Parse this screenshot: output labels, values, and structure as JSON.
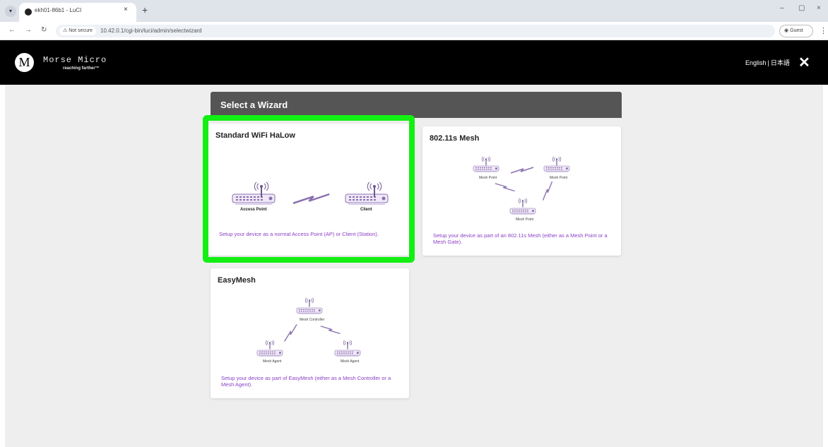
{
  "browser": {
    "tab_title": "ekh01-86b1 - LuCI",
    "tab_close": "×",
    "new_tab": "+",
    "tab_list": "▾",
    "not_secure": "⚠ Not secure",
    "url": "10.42.0.1/cgi-bin/luci/admin/selectwizard",
    "guest": "Guest",
    "window_controls": [
      "–",
      "▢",
      "×"
    ]
  },
  "header": {
    "logo_letter": "M",
    "brand_name": "Morse Micro",
    "brand_tagline": "reaching farther™",
    "lang_english": "English",
    "lang_sep": "|",
    "lang_japanese": "日本語",
    "close": "✕"
  },
  "page": {
    "title": "Select a Wizard"
  },
  "wizards": [
    {
      "title": "Standard WiFi HaLow",
      "desc": "Setup your device as a normal Access Point (AP) or Client (Station).",
      "labels": [
        "Access Point",
        "Client"
      ]
    },
    {
      "title": "802.11s Mesh",
      "desc": "Setup your device as part of an 802.11s Mesh (either as a Mesh Point or a Mesh Gate).",
      "labels": [
        "Mesh Point",
        "Mesh Point",
        "Mesh Point"
      ]
    },
    {
      "title": "EasyMesh",
      "desc": "Setup your device as part of EasyMesh (either as a Mesh Controller or a Mesh Agent).",
      "labels": [
        "Mesh Controller",
        "Mesh Agent",
        "Mesh Agent"
      ]
    }
  ],
  "colors": {
    "accent_purple": "#8a3fc8",
    "highlight_green": "#13ef13",
    "title_bar": "#555555",
    "header_bg": "#000000"
  },
  "icons": [
    "router-icon",
    "antenna-icon",
    "lightning-link-icon"
  ]
}
